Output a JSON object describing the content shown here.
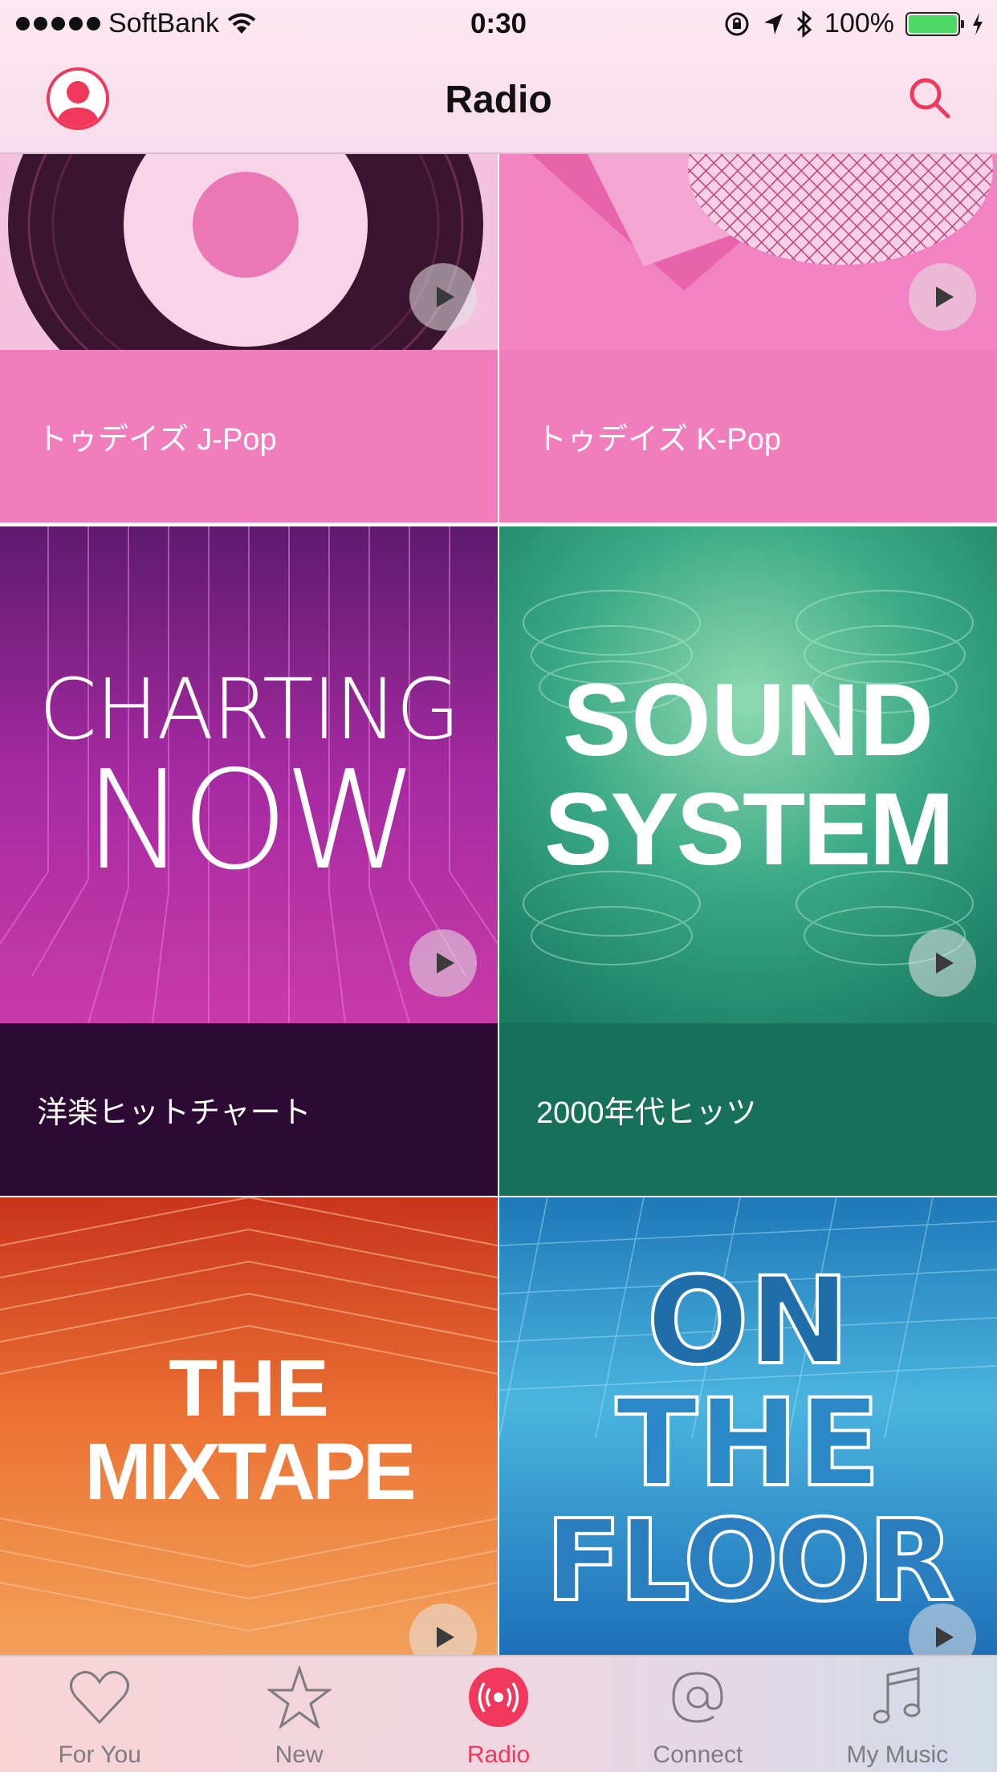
{
  "status_bar": {
    "carrier": "SoftBank",
    "time": "0:30",
    "battery": "100%"
  },
  "nav": {
    "title": "Radio"
  },
  "stations": [
    {
      "label": "トゥデイズ J-Pop",
      "label_bg": "#f07ebc"
    },
    {
      "label": "トゥデイズ K-Pop",
      "label_bg": "#f07ebc"
    },
    {
      "label": "洋楽ヒットチャート",
      "label_bg": "#2c0a33",
      "art_text_1": "CHARTING",
      "art_text_2": "NOW"
    },
    {
      "label": "2000年代ヒッツ",
      "label_bg": "#17705a",
      "art_text_1": "SOUND",
      "art_text_2": "SYSTEM"
    },
    {
      "art_text_1": "THE",
      "art_text_2": "MIXTAPE"
    },
    {
      "art_text_1": "ON",
      "art_text_2": "THE",
      "art_text_3": "FLOOR"
    }
  ],
  "tabs": [
    {
      "label": "For You",
      "icon": "heart-icon"
    },
    {
      "label": "New",
      "icon": "star-icon"
    },
    {
      "label": "Radio",
      "icon": "radio-icon",
      "active": true
    },
    {
      "label": "Connect",
      "icon": "at-icon"
    },
    {
      "label": "My Music",
      "icon": "music-note-icon"
    }
  ],
  "colors": {
    "accent": "#f2375c"
  }
}
